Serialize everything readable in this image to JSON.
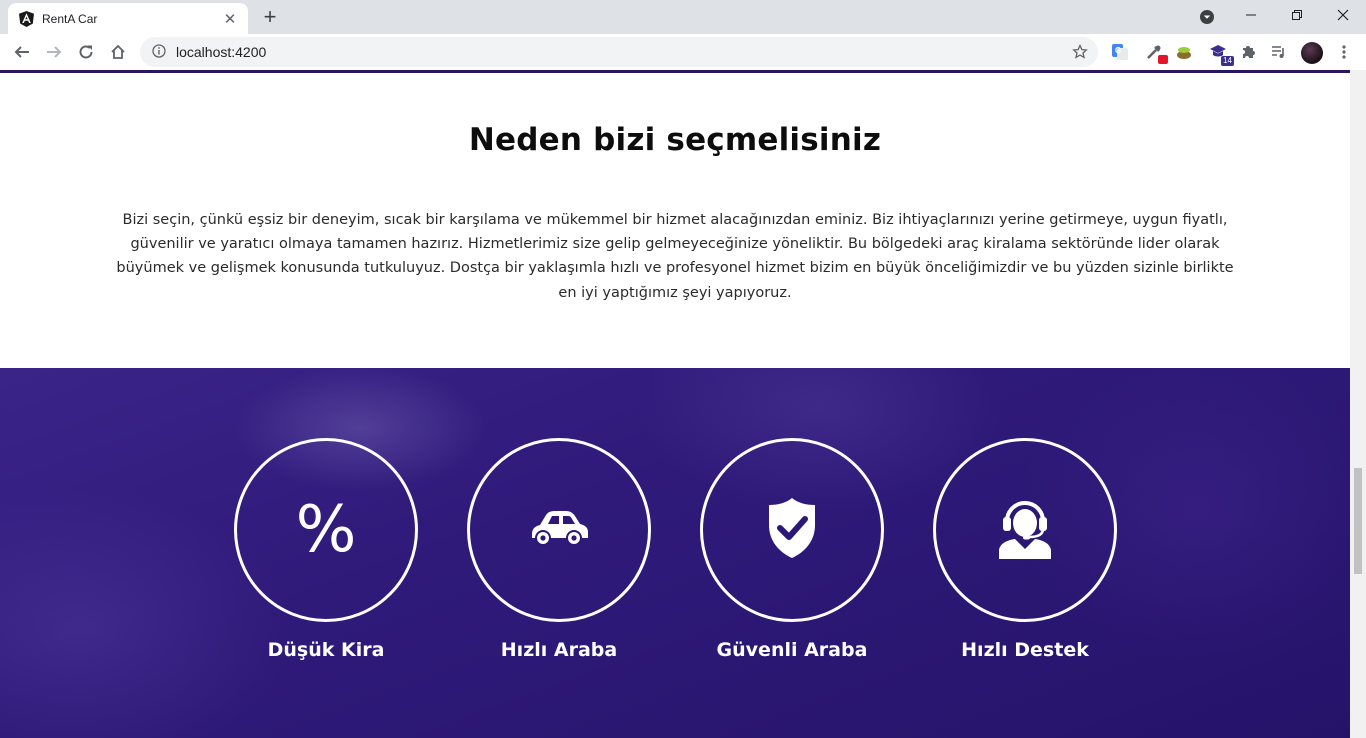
{
  "browser": {
    "tab_title": "RentA Car",
    "url": "localhost:4200",
    "extension_badge": "14"
  },
  "why_section": {
    "title": "Neden bizi seçmelisiniz",
    "text": "Bizi seçin, çünkü eşsiz bir deneyim, sıcak bir karşılama ve mükemmel bir hizmet alacağınızdan eminiz. Biz ihtiyaçlarınızı yerine getirmeye, uygun fiyatlı, güvenilir ve yaratıcı olmaya tamamen hazırız. Hizmetlerimiz size gelip gelmeyeceğinize yöneliktir. Bu bölgedeki araç kiralama sektöründe lider olarak büyümek ve gelişmek konusunda tutkuluyuz. Dostça bir yaklaşımla hızlı ve profesyonel hizmet bizim en büyük önceliğimizdir ve bu yüzden sizinle birlikte en iyi yaptığımız şeyi yapıyoruz."
  },
  "features": [
    {
      "icon": "percent-icon",
      "symbol": "%",
      "label": "Düşük Kira"
    },
    {
      "icon": "car-icon",
      "label": "Hızlı Araba"
    },
    {
      "icon": "shield-check-icon",
      "label": "Güvenli Araba"
    },
    {
      "icon": "headset-support-icon",
      "label": "Hızlı Destek"
    }
  ],
  "colors": {
    "accent": "#2a1660",
    "features_background": "#2d1877",
    "features_foreground": "#ffffff"
  }
}
